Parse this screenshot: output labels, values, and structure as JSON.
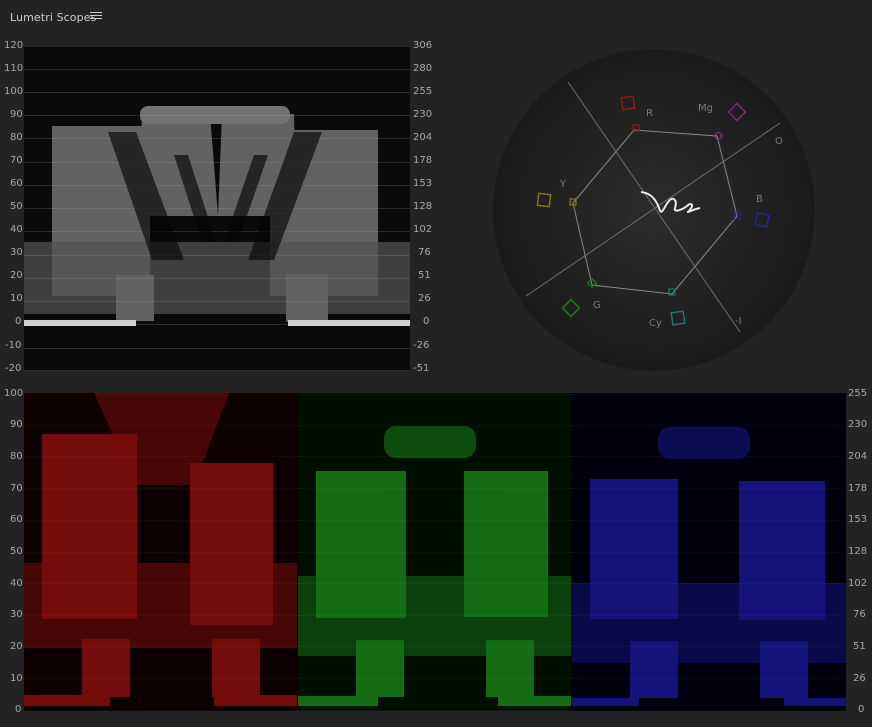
{
  "panel": {
    "title": "Lumetri Scopes",
    "menu_icon": "hamburger-icon"
  },
  "luma_waveform": {
    "left_scale": [
      "120",
      "110",
      "100",
      "90",
      "80",
      "70",
      "60",
      "50",
      "40",
      "30",
      "20",
      "10",
      "0",
      "-10",
      "-20"
    ],
    "right_scale": [
      "306",
      "280",
      "255",
      "230",
      "204",
      "178",
      "153",
      "128",
      "102",
      "76",
      "51",
      "26",
      "0",
      "-26",
      "-51"
    ]
  },
  "vectorscope": {
    "labels": {
      "r": "R",
      "mg": "Mg",
      "b": "B",
      "cy": "Cy",
      "g": "G",
      "y": "Y",
      "skin": "O",
      "minus": "-I"
    },
    "colors": {
      "red": "#8e1c1c",
      "magenta": "#7a2f7a",
      "blue": "#24269a",
      "cyan": "#1b7a7a",
      "green": "#1f7a1f",
      "yellow": "#8a7a12"
    }
  },
  "rgb_parade": {
    "left_scale": [
      "100",
      "90",
      "80",
      "70",
      "60",
      "50",
      "40",
      "30",
      "20",
      "10",
      "0"
    ],
    "right_scale": [
      "255",
      "230",
      "204",
      "178",
      "153",
      "128",
      "102",
      "76",
      "51",
      "26",
      "0"
    ],
    "colors": {
      "red": "#b21212",
      "green": "#1fa51f",
      "blue": "#1d1db8"
    }
  }
}
